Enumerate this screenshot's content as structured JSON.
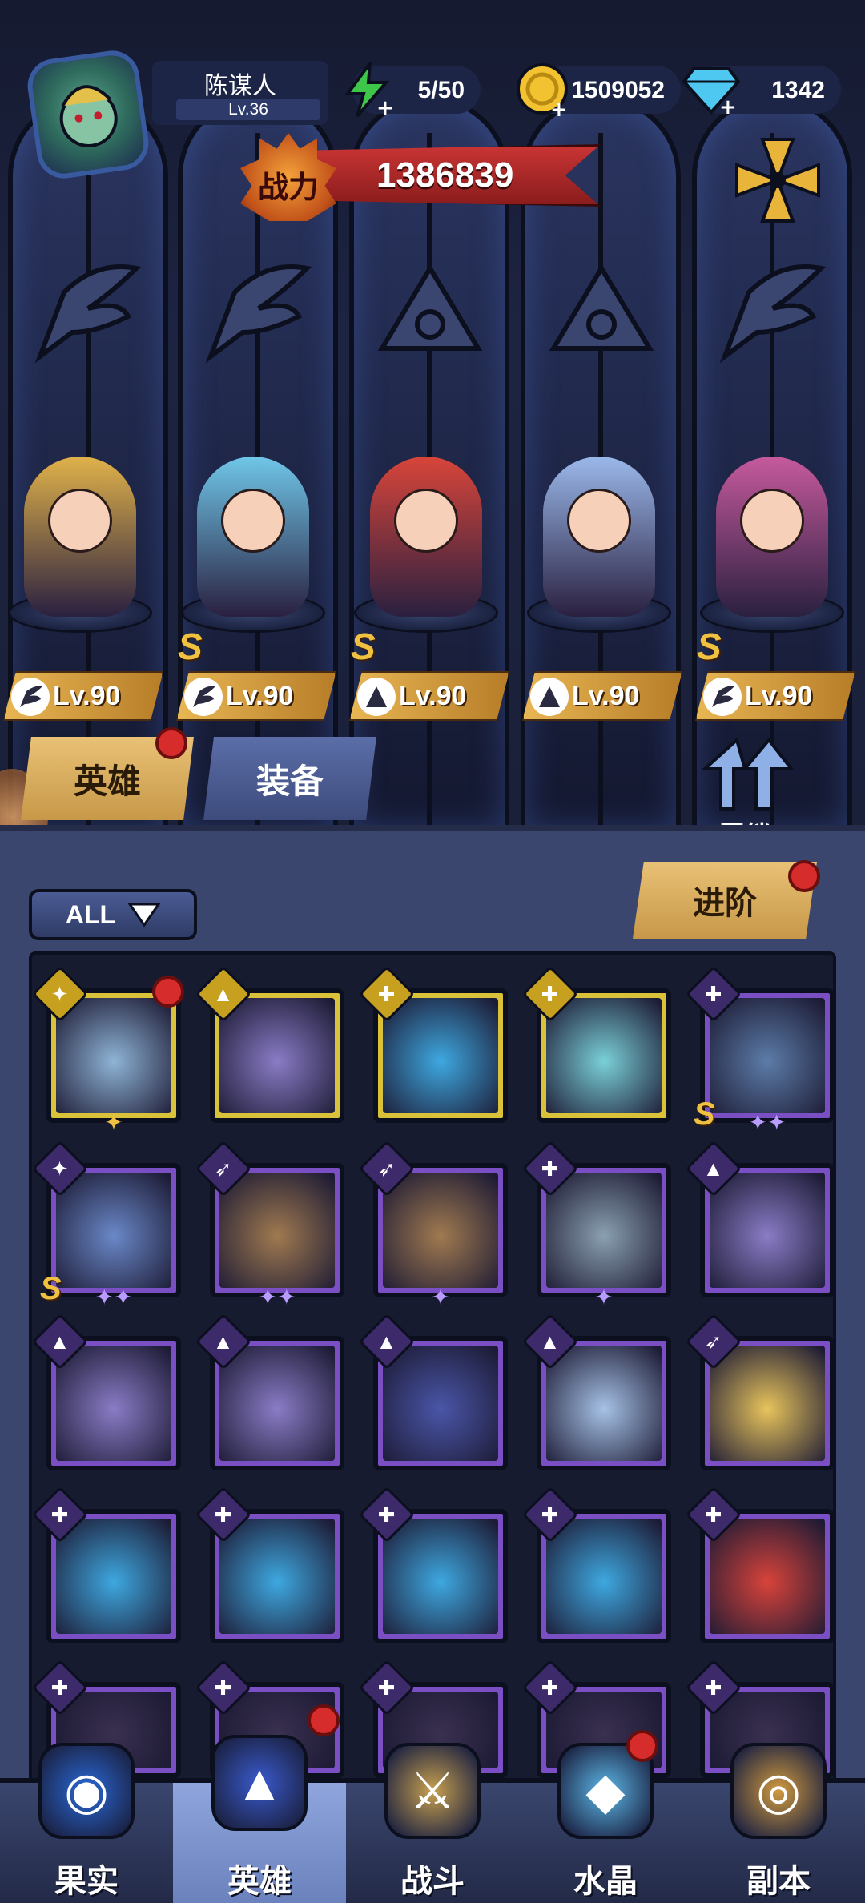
{
  "player": {
    "name": "陈谋人",
    "level": "Lv.36"
  },
  "resources": {
    "energy": "5/50",
    "gold": "1509052",
    "gems": "1342"
  },
  "power": {
    "label": "战力",
    "value": "1386839"
  },
  "lineup": [
    {
      "level": "Lv.90",
      "class_icon": "wing-icon",
      "rank": "",
      "color": "#e0b24a"
    },
    {
      "level": "Lv.90",
      "class_icon": "wing-icon",
      "rank": "S",
      "color": "#6fc6e8"
    },
    {
      "level": "Lv.90",
      "class_icon": "hat-icon",
      "rank": "S",
      "color": "#d8453a"
    },
    {
      "level": "Lv.90",
      "class_icon": "hat-icon",
      "rank": "",
      "color": "#9ab8ea"
    },
    {
      "level": "Lv.90",
      "class_icon": "wing-icon",
      "rank": "S",
      "color": "#c65a9c"
    }
  ],
  "tabs": {
    "hero": "英雄",
    "equipment": "装备"
  },
  "bond": {
    "label": "羁绊"
  },
  "filter": {
    "value": "ALL"
  },
  "advance": {
    "label": "进阶"
  },
  "roster": [
    {
      "frame": "gold",
      "cls": "✦",
      "stars": "✦",
      "rank": "",
      "art": "#8fb4d6"
    },
    {
      "frame": "gold",
      "cls": "▲",
      "stars": "",
      "rank": "",
      "art": "#8a7cc6"
    },
    {
      "frame": "gold",
      "cls": "✚",
      "stars": "",
      "rank": "",
      "art": "#3ea8e0"
    },
    {
      "frame": "gold",
      "cls": "✚",
      "stars": "",
      "rank": "",
      "art": "#7ad0d8"
    },
    {
      "frame": "purple",
      "cls": "✚",
      "stars": "✦✦",
      "rank": "S",
      "art": "#5c7ca8"
    },
    {
      "frame": "purple",
      "cls": "✦",
      "stars": "✦✦",
      "rank": "S",
      "art": "#6a88c8"
    },
    {
      "frame": "purple",
      "cls": "➶",
      "stars": "✦✦",
      "rank": "",
      "art": "#a07a50"
    },
    {
      "frame": "purple",
      "cls": "➶",
      "stars": "✦",
      "rank": "",
      "art": "#a07a50"
    },
    {
      "frame": "purple",
      "cls": "✚",
      "stars": "✦",
      "rank": "",
      "art": "#8aa0b0"
    },
    {
      "frame": "purple",
      "cls": "▲",
      "stars": "",
      "rank": "",
      "art": "#8a7cc6"
    },
    {
      "frame": "purple",
      "cls": "▲",
      "stars": "",
      "rank": "",
      "art": "#8a7cc6"
    },
    {
      "frame": "purple",
      "cls": "▲",
      "stars": "",
      "rank": "",
      "art": "#8a7cc6"
    },
    {
      "frame": "purple",
      "cls": "▲",
      "stars": "",
      "rank": "",
      "art": "#4a56a8"
    },
    {
      "frame": "purple",
      "cls": "▲",
      "stars": "",
      "rank": "",
      "art": "#a6c2e6"
    },
    {
      "frame": "purple",
      "cls": "➶",
      "stars": "",
      "rank": "",
      "art": "#e8c45c"
    },
    {
      "frame": "purple",
      "cls": "✚",
      "stars": "",
      "rank": "",
      "art": "#3ea8e0"
    },
    {
      "frame": "purple",
      "cls": "✚",
      "stars": "",
      "rank": "",
      "art": "#3ea8e0"
    },
    {
      "frame": "purple",
      "cls": "✚",
      "stars": "",
      "rank": "",
      "art": "#3ea8e0"
    },
    {
      "frame": "purple",
      "cls": "✚",
      "stars": "",
      "rank": "",
      "art": "#3ea8e0"
    },
    {
      "frame": "purple",
      "cls": "✚",
      "stars": "",
      "rank": "",
      "art": "#d8433a"
    },
    {
      "frame": "purple",
      "cls": "✚",
      "stars": "",
      "rank": "",
      "art": "#3a3050"
    },
    {
      "frame": "purple",
      "cls": "✚",
      "stars": "",
      "rank": "",
      "art": "#3a3050"
    },
    {
      "frame": "purple",
      "cls": "✚",
      "stars": "",
      "rank": "",
      "art": "#3a3050"
    },
    {
      "frame": "purple",
      "cls": "✚",
      "stars": "",
      "rank": "",
      "art": "#3a3050"
    },
    {
      "frame": "purple",
      "cls": "✚",
      "stars": "",
      "rank": "",
      "art": "#3a3050"
    }
  ],
  "nav": [
    {
      "label": "果实",
      "icon": "fruit-icon",
      "active": false
    },
    {
      "label": "英雄",
      "icon": "wizard-hat-icon",
      "active": true
    },
    {
      "label": "战斗",
      "icon": "sword-icon",
      "active": false
    },
    {
      "label": "水晶",
      "icon": "crystal-icon",
      "active": false
    },
    {
      "label": "副本",
      "icon": "portal-icon",
      "active": false
    }
  ]
}
